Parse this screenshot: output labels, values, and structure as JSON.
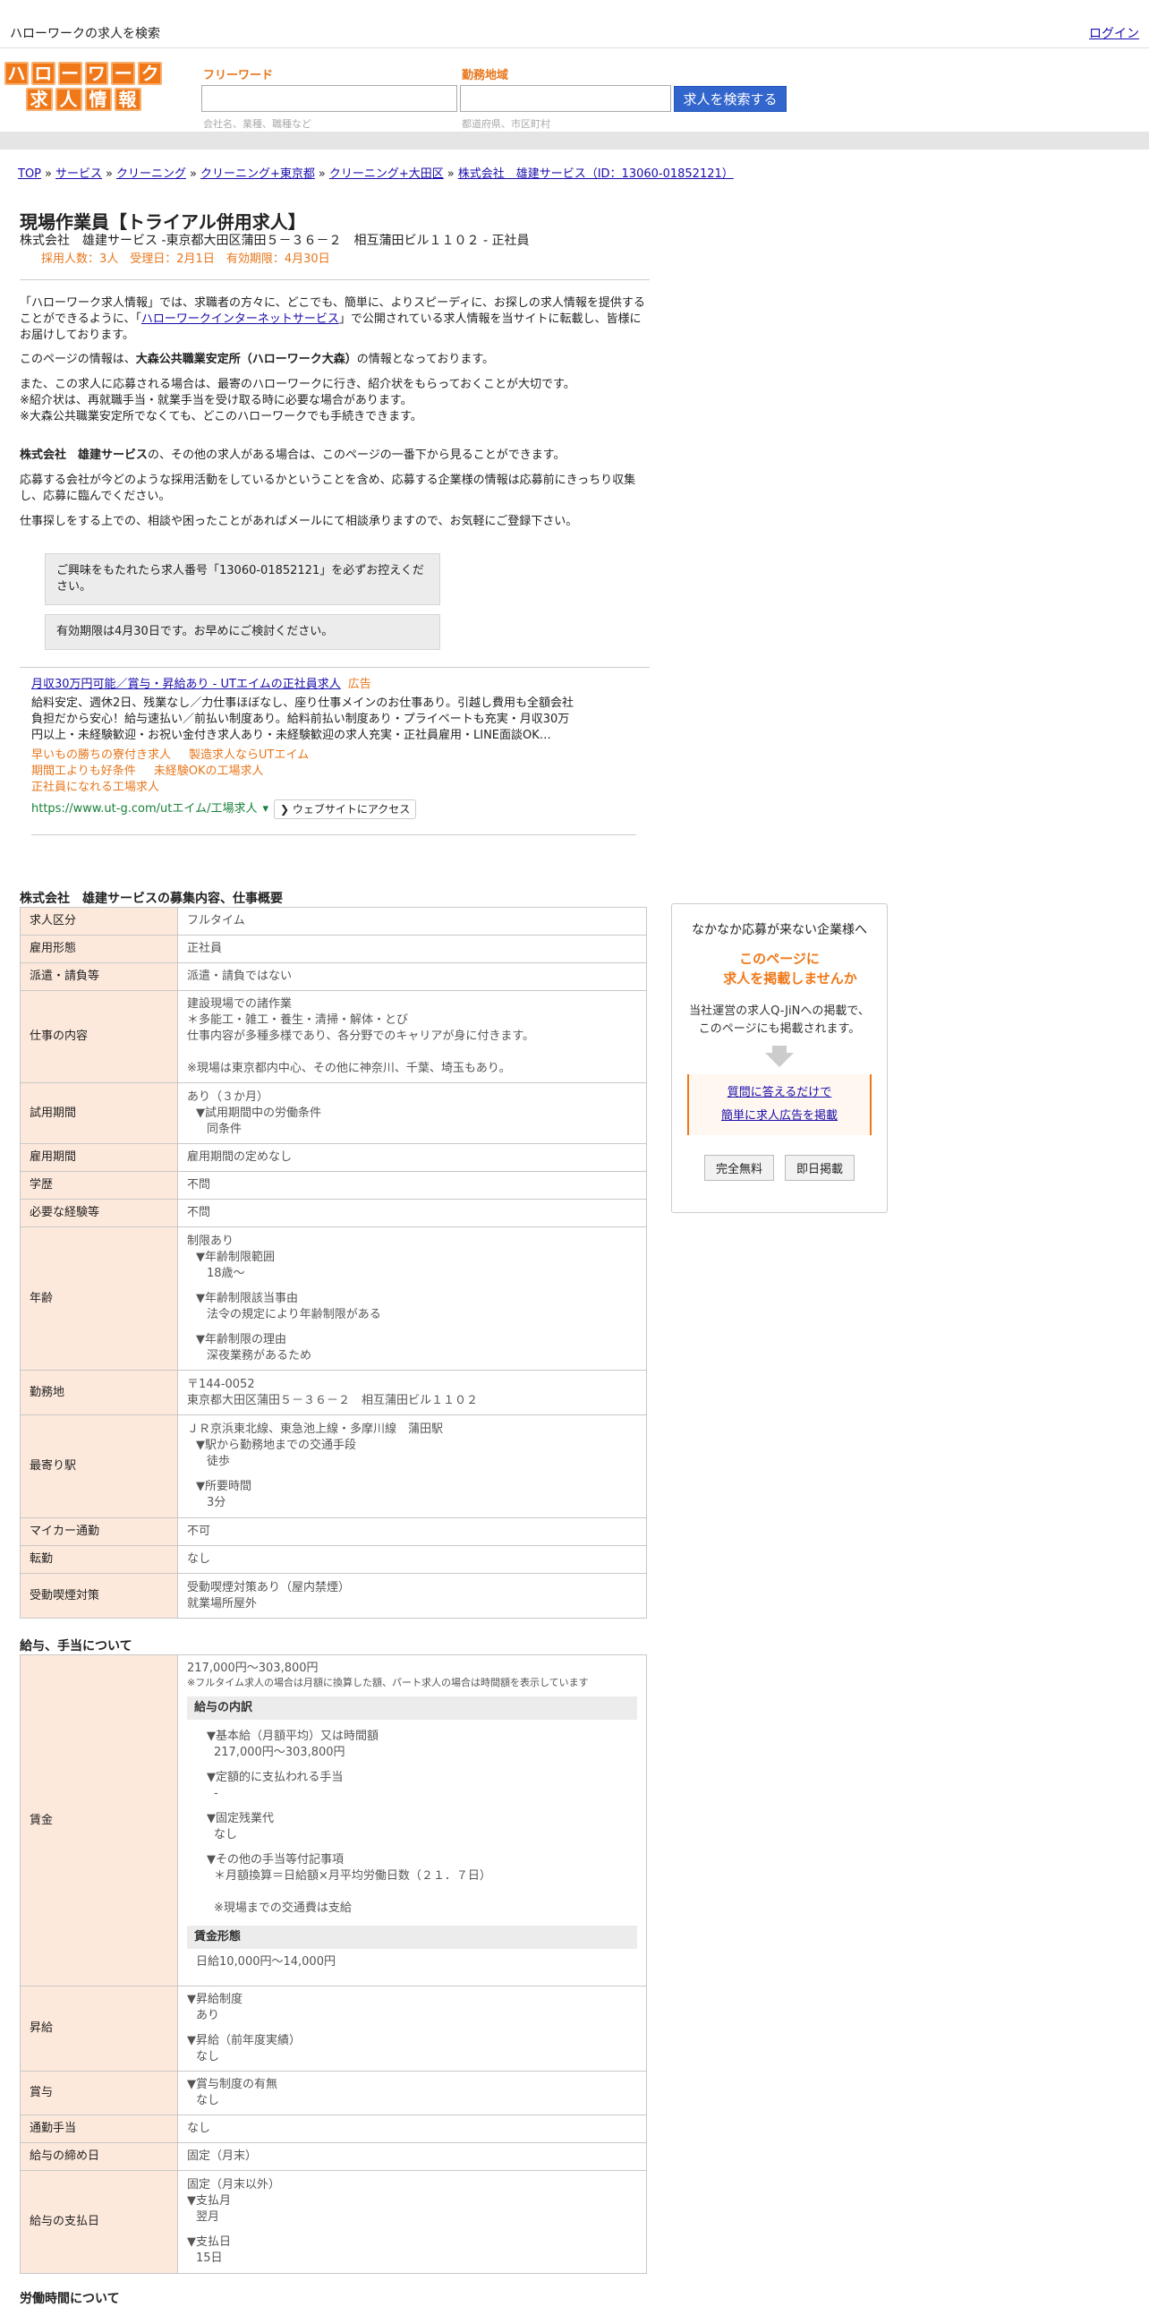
{
  "topbar": {
    "site_title": "ハローワークの求人を検索",
    "login": "ログイン"
  },
  "logo": {
    "row1": [
      "ハ",
      "ロ",
      "ー",
      "ワ",
      "ー",
      "ク"
    ],
    "row2": [
      "求",
      "人",
      "情",
      "報"
    ]
  },
  "search": {
    "freeword_label": "フリーワード",
    "freeword_hint": "会社名、業種、職種など",
    "area_label": "勤務地域",
    "area_hint": "都道府県、市区町村",
    "button": "求人を検索する"
  },
  "breadcrumb": [
    "TOP",
    "サービス",
    "クリーニング",
    "クリーニング+東京都",
    "クリーニング+大田区",
    "株式会社　雄建サービス（ID：13060-01852121）"
  ],
  "job": {
    "title": "現場作業員【トライアル併用求人】",
    "subtitle": "株式会社　雄建サービス -東京都大田区蒲田５－３６－２　相互蒲田ビル１１０２ - 正社員",
    "meta": "採用人数：3人　受理日：2月1日　有効期限：4月30日"
  },
  "intro": {
    "p1a": "「ハローワーク求人情報」では、求職者の方々に、どこでも、簡単に、よりスピーディに、お探しの求人情報を提供することができるように、「",
    "p1link": "ハローワークインターネットサービス",
    "p1b": "」で公開されている求人情報を当サイトに転載し、皆様にお届けしております。",
    "p2a": "このページの情報は、",
    "p2b": "大森公共職業安定所（ハローワーク大森）",
    "p2c": "の情報となっております。",
    "p3": "また、この求人に応募される場合は、最寄のハローワークに行き、紹介状をもらっておくことが大切です。",
    "p4": "※紹介状は、再就職手当・就業手当を受け取る時に必要な場合があります。",
    "p5": "※大森公共職業安定所でなくても、どこのハローワークでも手続きできます。",
    "p6a": "株式会社　雄建サービス",
    "p6b": "の、その他の求人がある場合は、このページの一番下から見ることができます。",
    "p7": "応募する会社が今どのような採用活動をしているかということを含め、応募する企業様の情報は応募前にきっちり収集し、応募に臨んでください。",
    "p8": "仕事探しをする上での、相談や困ったことがあればメールにて相談承りますので、お気軽にご登録下さい。"
  },
  "notes": {
    "n1": "ご興味をもたれたら求人番号「13060-01852121」を必ずお控えください。",
    "n2": "有効期限は4月30日です。お早めにご検討ください。"
  },
  "ad": {
    "title": "月収30万円可能／賞与・昇給あり - UTエイムの正社員求人",
    "tag": "広告",
    "desc": "給料安定、週休2日、残業なし／力仕事ほぼなし、座り仕事メインのお仕事あり。引越し費用も全額会社負担だから安心！給与速払い／前払い制度あり。給料前払い制度あり・プライベートも充実・月収30万円以上・未経験歓迎・お祝い金付き求人あり・未経験歓迎の求人充実・正社員雇用・LINE面談OK…",
    "sublinks": [
      "早いもの勝ちの寮付き求人",
      "製造求人ならUTエイム",
      "期間工よりも好条件",
      "未経験OKの工場求人",
      "正社員になれる工場求人"
    ],
    "url": "https://www.ut-g.com/utエイム/工場求人",
    "visit": "❯ ウェブサイトにアクセス"
  },
  "section1": {
    "title": "株式会社　雄建サービスの募集内容、仕事概要",
    "rows": {
      "kubun": {
        "label": "求人区分",
        "value": "フルタイム"
      },
      "keitai": {
        "label": "雇用形態",
        "value": "正社員"
      },
      "haken": {
        "label": "派遣・請負等",
        "value": "派遣・請負ではない"
      },
      "naiyou": {
        "label": "仕事の内容",
        "l1": "建設現場での諸作業",
        "l2": "＊多能工・雑工・養生・清掃・解体・とび",
        "l3": "仕事内容が多種多様であり、各分野でのキャリアが身に付きます。",
        "l4": "※現場は東京都内中心、その他に神奈川、千葉、埼玉もあり。"
      },
      "shiyou": {
        "label": "試用期間",
        "l1": "あり（３か月）",
        "l2": "▼試用期間中の労働条件",
        "l3": "同条件"
      },
      "kikan": {
        "label": "雇用期間",
        "value": "雇用期間の定めなし"
      },
      "gakureki": {
        "label": "学歴",
        "value": "不問"
      },
      "keiken": {
        "label": "必要な経験等",
        "value": "不問"
      },
      "nenrei": {
        "label": "年齢",
        "l1": "制限あり",
        "l2": "▼年齢制限範囲",
        "l3": "18歳〜",
        "l4": "▼年齢制限該当事由",
        "l5": "法令の規定により年齢制限がある",
        "l6": "▼年齢制限の理由",
        "l7": "深夜業務があるため"
      },
      "kinmuchi": {
        "label": "勤務地",
        "l1": "〒144-0052",
        "l2": "東京都大田区蒲田５－３６－２　相互蒲田ビル１１０２"
      },
      "eki": {
        "label": "最寄り駅",
        "l1": "ＪＲ京浜東北線、東急池上線・多摩川線　蒲田駅",
        "l2": "▼駅から勤務地までの交通手段",
        "l3": "徒歩",
        "l4": "▼所要時間",
        "l5": "3分"
      },
      "mycar": {
        "label": "マイカー通勤",
        "value": "不可"
      },
      "tenkin": {
        "label": "転勤",
        "value": "なし"
      },
      "judou": {
        "label": "受動喫煙対策",
        "l1": "受動喫煙対策あり（屋内禁煙）",
        "l2": "就業場所屋外"
      }
    }
  },
  "section2": {
    "title": "給与、手当について",
    "chingin": {
      "label": "賃金",
      "range": "217,000円〜303,800円",
      "note": "※フルタイム求人の場合は月額に換算した額、パート求人の場合は時間額を表示しています",
      "uchiwake_head": "給与の内訳",
      "k1": "▼基本給（月額平均）又は時間額",
      "k2": "217,000円〜303,800円",
      "k3": "▼定額的に支払われる手当",
      "k4": "-",
      "k5": "▼固定残業代",
      "k6": "なし",
      "k7": "▼その他の手当等付記事項",
      "k8": "＊月額換算＝日給額×月平均労働日数（２１．７日）",
      "k9": "※現場までの交通費は支給",
      "keitai_head": "賃金形態",
      "keitai": "日給10,000円〜14,000円"
    },
    "shoukyu": {
      "label": "昇給",
      "l1": "▼昇給制度",
      "l2": "あり",
      "l3": "▼昇給（前年度実績）",
      "l4": "なし"
    },
    "shouyo": {
      "label": "賞与",
      "l1": "▼賞与制度の有無",
      "l2": "なし"
    },
    "tsukin": {
      "label": "通勤手当",
      "value": "なし"
    },
    "shime": {
      "label": "給与の締め日",
      "value": "固定（月末）"
    },
    "shiharai": {
      "label": "給与の支払日",
      "l1": "固定（月末以外）",
      "l2": "▼支払月",
      "l3": "翌月",
      "l4": "▼支払日",
      "l5": "15日"
    }
  },
  "section3": {
    "title": "労働時間について"
  },
  "side": {
    "title": "なかなか応募が来ない企業様へ",
    "orange1": "このページに",
    "orange2": "求人を掲載しませんか",
    "text1": "当社運営の求人Q-JiNへの掲載で、",
    "text2": "このページにも掲載されます。",
    "link1": "質問に答えるだけで",
    "link2": "簡単に求人広告を掲載",
    "btn1": "完全無料",
    "btn2": "即日掲載"
  }
}
